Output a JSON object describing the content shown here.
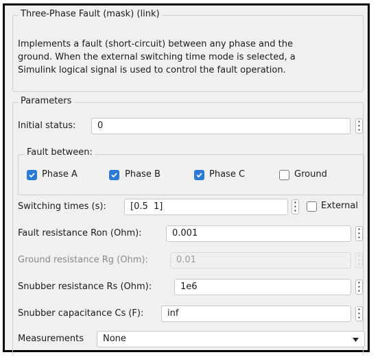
{
  "block": {
    "title": "Three-Phase Fault (mask) (link)",
    "description": [
      "Implements a fault (short-circuit) between any phase and the",
      "ground. When the external switching time mode is selected, a",
      "Simulink logical signal is used to control the fault operation."
    ]
  },
  "parameters": {
    "section_label": "Parameters",
    "initial_status": {
      "label": "Initial status:",
      "value": "0"
    },
    "fault_between": {
      "label": "Fault between:",
      "options": [
        {
          "label": "Phase A",
          "checked": true
        },
        {
          "label": "Phase B",
          "checked": true
        },
        {
          "label": "Phase C",
          "checked": true
        },
        {
          "label": "Ground",
          "checked": false
        }
      ]
    },
    "switching_times": {
      "label": "Switching times (s):",
      "value": "[0.5  1]",
      "external_label": "External",
      "external_checked": false
    },
    "fault_resistance": {
      "label": "Fault resistance Ron (Ohm):",
      "value": "0.001"
    },
    "ground_resistance": {
      "label": "Ground resistance Rg (Ohm):",
      "value": "0.01",
      "enabled": false
    },
    "snubber_resistance": {
      "label": "Snubber resistance Rs (Ohm):",
      "value": "1e6"
    },
    "snubber_capacitance": {
      "label": "Snubber capacitance Cs (F):",
      "value": "inf"
    },
    "measurements": {
      "label": "Measurements",
      "value": "None"
    }
  },
  "colors": {
    "accent": "#2a7ad6",
    "panel": "#f0f0f0",
    "border": "#000000"
  },
  "icons": {
    "field_menu": "vertical-ellipsis-icon",
    "dropdown": "caret-down-icon",
    "check": "checkmark-icon"
  }
}
